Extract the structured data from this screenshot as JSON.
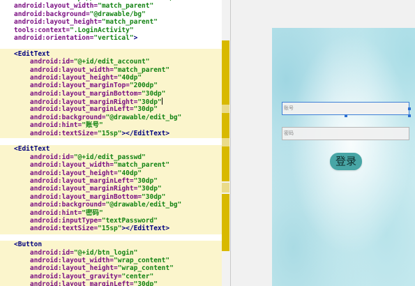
{
  "editor": {
    "lines": [
      {
        "indent": "",
        "parts": [
          {
            "t": "attr",
            "v": "xmlns:tools="
          },
          {
            "t": "str",
            "v": "\"http://schemas.android.com/tools\""
          }
        ]
      },
      {
        "indent": "",
        "parts": [
          {
            "t": "attr",
            "v": "android:layout_width="
          },
          {
            "t": "str",
            "v": "\"match_parent\""
          }
        ]
      },
      {
        "indent": "",
        "parts": [
          {
            "t": "attr",
            "v": "android:background="
          },
          {
            "t": "str",
            "v": "\"@drawable/bg\""
          }
        ]
      },
      {
        "indent": "",
        "parts": [
          {
            "t": "attr",
            "v": "android:layout_height="
          },
          {
            "t": "str",
            "v": "\"match_parent\""
          }
        ]
      },
      {
        "indent": "",
        "parts": [
          {
            "t": "attr",
            "v": "tools:context="
          },
          {
            "t": "str",
            "v": "\".LoginActivity\""
          }
        ]
      },
      {
        "indent": "",
        "parts": [
          {
            "t": "attr",
            "v": "android:orientation="
          },
          {
            "t": "str",
            "v": "\"vertical\""
          },
          {
            "t": "tag",
            "v": ">"
          }
        ]
      },
      {
        "indent": "",
        "parts": []
      },
      {
        "indent": "",
        "parts": [
          {
            "t": "tag",
            "v": "<EditText"
          }
        ]
      },
      {
        "indent": "    ",
        "parts": [
          {
            "t": "attr",
            "v": "android:id="
          },
          {
            "t": "str",
            "v": "\"@+id/edit_account\""
          }
        ]
      },
      {
        "indent": "    ",
        "parts": [
          {
            "t": "attr",
            "v": "android:layout_width="
          },
          {
            "t": "str",
            "v": "\"match_parent\""
          }
        ]
      },
      {
        "indent": "    ",
        "parts": [
          {
            "t": "attr",
            "v": "android:layout_height="
          },
          {
            "t": "str",
            "v": "\"40dp\""
          }
        ]
      },
      {
        "indent": "    ",
        "parts": [
          {
            "t": "attr",
            "v": "android:layout_marginTop="
          },
          {
            "t": "str",
            "v": "\"200dp\""
          }
        ]
      },
      {
        "indent": "    ",
        "parts": [
          {
            "t": "attr",
            "v": "android:layout_marginBottom="
          },
          {
            "t": "str",
            "v": "\"30dp\""
          }
        ]
      },
      {
        "indent": "    ",
        "parts": [
          {
            "t": "attr",
            "v": "android:layout_marginRight="
          },
          {
            "t": "str",
            "v": "\"30dp\""
          },
          {
            "t": "caret",
            "v": ""
          }
        ]
      },
      {
        "indent": "    ",
        "parts": [
          {
            "t": "attr",
            "v": "android:layout_marginLeft="
          },
          {
            "t": "str",
            "v": "\"30dp\""
          }
        ]
      },
      {
        "indent": "    ",
        "parts": [
          {
            "t": "attr",
            "v": "android:background="
          },
          {
            "t": "str",
            "v": "\"@drawable/edit_bg\""
          }
        ]
      },
      {
        "indent": "    ",
        "parts": [
          {
            "t": "attr",
            "v": "android:hint="
          },
          {
            "t": "str",
            "v": "\"账号\""
          }
        ]
      },
      {
        "indent": "    ",
        "parts": [
          {
            "t": "attr",
            "v": "android:textSize="
          },
          {
            "t": "str",
            "v": "\"15sp\""
          },
          {
            "t": "tag",
            "v": "></EditText>"
          }
        ]
      },
      {
        "indent": "",
        "parts": []
      },
      {
        "indent": "",
        "parts": [
          {
            "t": "tag",
            "v": "<EditText"
          }
        ]
      },
      {
        "indent": "    ",
        "parts": [
          {
            "t": "attr",
            "v": "android:id="
          },
          {
            "t": "str",
            "v": "\"@+id/edit_passwd\""
          }
        ]
      },
      {
        "indent": "    ",
        "parts": [
          {
            "t": "attr",
            "v": "android:layout_width="
          },
          {
            "t": "str",
            "v": "\"match_parent\""
          }
        ]
      },
      {
        "indent": "    ",
        "parts": [
          {
            "t": "attr",
            "v": "android:layout_height="
          },
          {
            "t": "str",
            "v": "\"40dp\""
          }
        ]
      },
      {
        "indent": "    ",
        "parts": [
          {
            "t": "attr",
            "v": "android:layout_marginLeft="
          },
          {
            "t": "str",
            "v": "\"30dp\""
          }
        ]
      },
      {
        "indent": "    ",
        "parts": [
          {
            "t": "attr",
            "v": "android:layout_marginRight="
          },
          {
            "t": "str",
            "v": "\"30dp\""
          }
        ]
      },
      {
        "indent": "    ",
        "parts": [
          {
            "t": "attr",
            "v": "android:layout_marginBottom="
          },
          {
            "t": "str",
            "v": "\"30dp\""
          }
        ]
      },
      {
        "indent": "    ",
        "parts": [
          {
            "t": "attr",
            "v": "android:background="
          },
          {
            "t": "str",
            "v": "\"@drawable/edit_bg\""
          }
        ]
      },
      {
        "indent": "    ",
        "parts": [
          {
            "t": "attr",
            "v": "android:hint="
          },
          {
            "t": "str",
            "v": "\"密码\""
          }
        ]
      },
      {
        "indent": "    ",
        "parts": [
          {
            "t": "attr",
            "v": "android:inputType="
          },
          {
            "t": "str",
            "v": "\"textPassword\""
          }
        ]
      },
      {
        "indent": "    ",
        "parts": [
          {
            "t": "attr",
            "v": "android:textSize="
          },
          {
            "t": "str",
            "v": "\"15sp\""
          },
          {
            "t": "tag",
            "v": "></EditText>"
          }
        ]
      },
      {
        "indent": "",
        "parts": []
      },
      {
        "indent": "",
        "parts": [
          {
            "t": "tag",
            "v": "<Button"
          }
        ]
      },
      {
        "indent": "    ",
        "parts": [
          {
            "t": "attr",
            "v": "android:id="
          },
          {
            "t": "str",
            "v": "\"@+id/btn_login\""
          }
        ]
      },
      {
        "indent": "    ",
        "parts": [
          {
            "t": "attr",
            "v": "android:layout_width="
          },
          {
            "t": "str",
            "v": "\"wrap_content\""
          }
        ]
      },
      {
        "indent": "    ",
        "parts": [
          {
            "t": "attr",
            "v": "android:layout_height="
          },
          {
            "t": "str",
            "v": "\"wrap_content\""
          }
        ]
      },
      {
        "indent": "    ",
        "parts": [
          {
            "t": "attr",
            "v": "android:layout_gravity="
          },
          {
            "t": "str",
            "v": "\"center\""
          }
        ]
      },
      {
        "indent": "    ",
        "parts": [
          {
            "t": "attr",
            "v": "android:layout_marginLeft="
          },
          {
            "t": "str",
            "v": "\"30dp\""
          }
        ]
      }
    ]
  },
  "preview": {
    "account_hint": "账号",
    "password_hint": "密码",
    "login_label": "登录"
  },
  "colors": {
    "attribute": "#7b0f82",
    "string": "#138313",
    "tag": "#00007f",
    "highlight": "#fbf5cc",
    "marker": "#d8b900",
    "button": "#48a6a6"
  }
}
